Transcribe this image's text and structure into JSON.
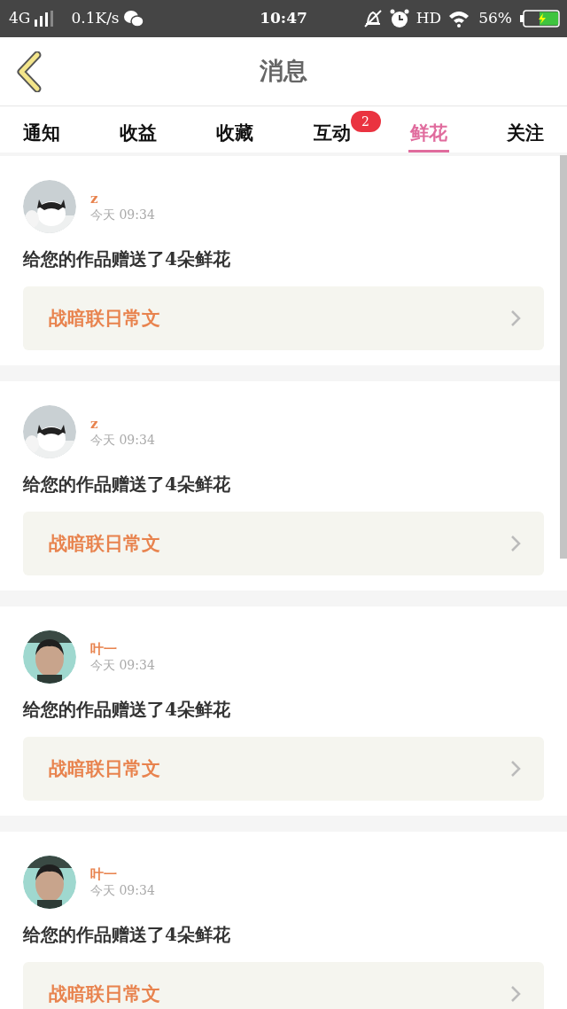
{
  "status_bar": {
    "network": "4G",
    "speed": "0.1K/s",
    "time": "10:47",
    "hd": "HD",
    "battery": "56%"
  },
  "header": {
    "title": "消息"
  },
  "tabs": [
    {
      "label": "通知",
      "selected": false
    },
    {
      "label": "收益",
      "selected": false
    },
    {
      "label": "收藏",
      "selected": false
    },
    {
      "label": "互动",
      "selected": false,
      "badge": "2"
    },
    {
      "label": "鲜花",
      "selected": true
    },
    {
      "label": "关注",
      "selected": false
    }
  ],
  "messages": [
    {
      "user": "z",
      "time": "今天 09:34",
      "text": "给您的作品赠送了4朵鲜花",
      "work": "战暗联日常文"
    },
    {
      "user": "z",
      "time": "今天 09:34",
      "text": "给您的作品赠送了4朵鲜花",
      "work": "战暗联日常文"
    },
    {
      "user": "叶一",
      "time": "今天 09:34",
      "text": "给您的作品赠送了4朵鲜花",
      "work": "战暗联日常文"
    },
    {
      "user": "叶一",
      "time": "今天 09:34",
      "text": "给您的作品赠送了4朵鲜花",
      "work": "战暗联日常文"
    }
  ]
}
